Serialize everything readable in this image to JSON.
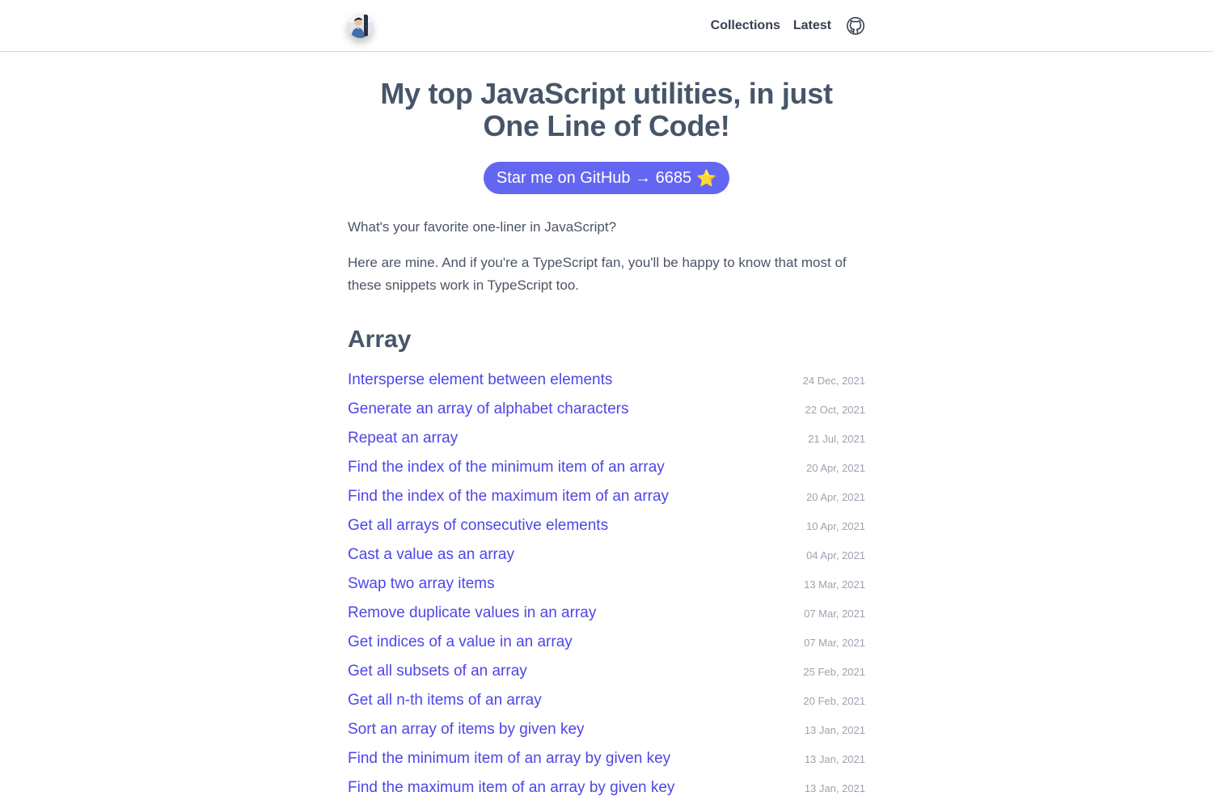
{
  "nav": {
    "collections": "Collections",
    "latest": "Latest",
    "github_icon": "github-icon"
  },
  "main": {
    "title_line1": "My top JavaScript utilities, in just",
    "title_line2": "One Line of Code!",
    "star_button": "Star me on GitHub → 6685",
    "star_emoji": "⭐",
    "intro1": "What's your favorite one-liner in JavaScript?",
    "intro2": "Here are mine. And if you're a TypeScript fan, you'll be happy to know that most of these snippets work in TypeScript too.",
    "section_title": "Array",
    "items": [
      {
        "title": "Intersperse element between elements",
        "date": "24 Dec, 2021"
      },
      {
        "title": "Generate an array of alphabet characters",
        "date": "22 Oct, 2021"
      },
      {
        "title": "Repeat an array",
        "date": "21 Jul, 2021"
      },
      {
        "title": "Find the index of the minimum item of an array",
        "date": "20 Apr, 2021"
      },
      {
        "title": "Find the index of the maximum item of an array",
        "date": "20 Apr, 2021"
      },
      {
        "title": "Get all arrays of consecutive elements",
        "date": "10 Apr, 2021"
      },
      {
        "title": "Cast a value as an array",
        "date": "04 Apr, 2021"
      },
      {
        "title": "Swap two array items",
        "date": "13 Mar, 2021"
      },
      {
        "title": "Remove duplicate values in an array",
        "date": "07 Mar, 2021"
      },
      {
        "title": "Get indices of a value in an array",
        "date": "07 Mar, 2021"
      },
      {
        "title": "Get all subsets of an array",
        "date": "25 Feb, 2021"
      },
      {
        "title": "Get all n-th items of an array",
        "date": "20 Feb, 2021"
      },
      {
        "title": "Sort an array of items by given key",
        "date": "13 Jan, 2021"
      },
      {
        "title": "Find the minimum item of an array by given key",
        "date": "13 Jan, 2021"
      },
      {
        "title": "Find the maximum item of an array by given key",
        "date": "13 Jan, 2021"
      }
    ]
  }
}
